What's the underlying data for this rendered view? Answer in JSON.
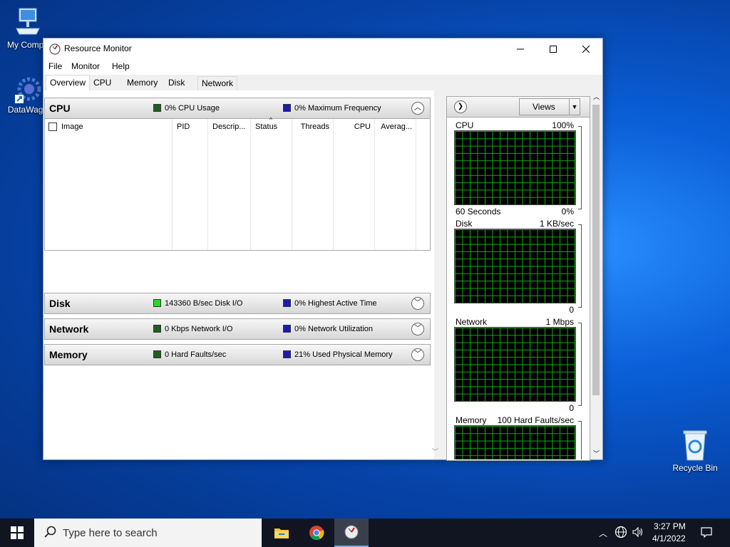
{
  "desktop": {
    "icons": [
      {
        "label": "My Compu",
        "icon": "computer-icon"
      },
      {
        "label": "DataWago",
        "icon": "gear-icon"
      },
      {
        "label": "Recycle Bin",
        "icon": "recycle-bin-icon"
      }
    ]
  },
  "window": {
    "title": "Resource Monitor",
    "menu": [
      "File",
      "Monitor",
      "Help"
    ],
    "tabs": [
      "Overview",
      "CPU",
      "Memory",
      "Disk",
      "Network"
    ],
    "active_tab": "Overview"
  },
  "sections": {
    "cpu": {
      "title": "CPU",
      "legend1": "0% CPU Usage",
      "legend1_color": "#1e5f1e",
      "legend2": "0% Maximum Frequency",
      "legend2_color": "#1a1ab4",
      "columns": [
        "Image",
        "PID",
        "Descrip...",
        "Status",
        "Threads",
        "CPU",
        "Averag..."
      ]
    },
    "disk": {
      "title": "Disk",
      "legend1": "143360 B/sec Disk I/O",
      "legend1_color": "#22dd22",
      "legend2": "0% Highest Active Time",
      "legend2_color": "#1a1ab4"
    },
    "network": {
      "title": "Network",
      "legend1": "0 Kbps Network I/O",
      "legend1_color": "#1e5f1e",
      "legend2": "0% Network Utilization",
      "legend2_color": "#1a1ab4"
    },
    "memory": {
      "title": "Memory",
      "legend1": "0 Hard Faults/sec",
      "legend1_color": "#1e5f1e",
      "legend2": "21% Used Physical Memory",
      "legend2_color": "#1a1ab4"
    }
  },
  "right_panel": {
    "views_label": "Views",
    "graphs": [
      {
        "name": "CPU",
        "top_right": "100%",
        "bottom_left": "60 Seconds",
        "bottom_right": "0%"
      },
      {
        "name": "Disk",
        "top_right": "1 KB/sec",
        "bottom_left": "",
        "bottom_right": "0"
      },
      {
        "name": "Network",
        "top_right": "1 Mbps",
        "bottom_left": "",
        "bottom_right": "0"
      },
      {
        "name": "Memory",
        "top_right": "100 Hard Faults/sec",
        "bottom_left": "",
        "bottom_right": ""
      }
    ]
  },
  "taskbar": {
    "search_placeholder": "Type here to search",
    "time": "3:27 PM",
    "date": "4/1/2022"
  }
}
